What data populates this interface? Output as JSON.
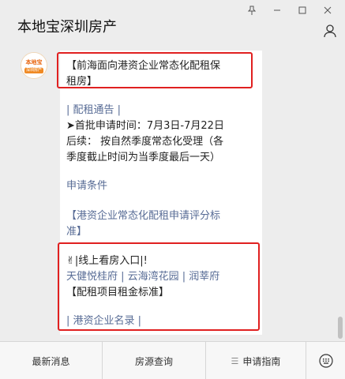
{
  "header": {
    "title": "本地宝深圳房产",
    "pin_icon": "pin-icon",
    "minimize_icon": "minimize-icon",
    "maximize_icon": "maximize-icon",
    "close_icon": "close-icon",
    "profile_icon": "person-icon"
  },
  "avatar": {
    "brand": "本地宝",
    "sub": "bendibao.com",
    "tag": "深圳房产"
  },
  "message": {
    "line1": "【前海面向港资企业常态化配租保",
    "line2": "租房】",
    "line3": "| 配租通告 |",
    "line4": "➤首批申请时间：7月3日-7月22日",
    "line5": "后续：  按自然季度常态化受理（各",
    "line6": "季度截止时间为当季度最后一天）",
    "line7": "申请条件",
    "line8": "【港资企业常态化配租申请评分标",
    "line9": "准】",
    "line10": "✌|线上看房入口|!",
    "line11": "天健悦桂府 | 云海湾花园 | 润莘府",
    "line12": "【配租项目租金标准】",
    "line13": "| 港资企业名录 |"
  },
  "menu": {
    "item1": "最新消息",
    "item2": "房源查询",
    "item3_prefix": "☰",
    "item3": "申请指南",
    "keyboard_icon": "keyboard-icon"
  },
  "colors": {
    "link": "#576b95",
    "highlight_border": "#e02020",
    "background": "#ededed"
  }
}
